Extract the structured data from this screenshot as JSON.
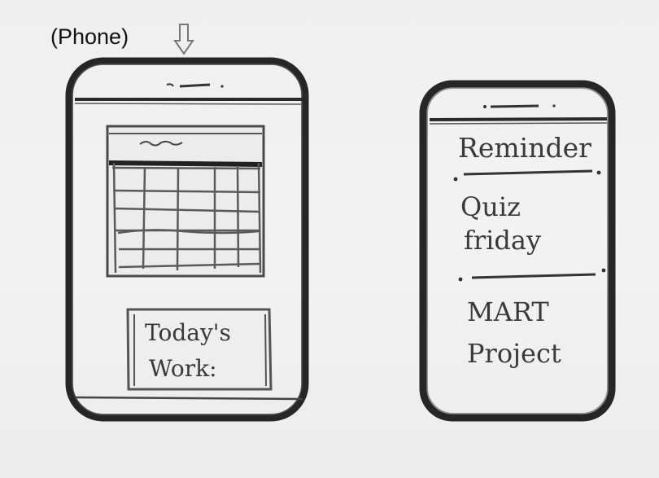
{
  "caption": {
    "phone_label": "(Phone)",
    "arrow_icon": "down-arrow-icon"
  },
  "left_phone": {
    "widgets": {
      "calendar": "calendar-grid",
      "todays_work_label_line1": "Today's",
      "todays_work_label_line2": "Work:"
    }
  },
  "right_phone": {
    "title": "Reminder",
    "items": [
      {
        "line1": "Quiz",
        "line2": "friday"
      },
      {
        "line1": "MART",
        "line2": "Project"
      }
    ]
  },
  "colors": {
    "pencil": "#3a3a3a",
    "paper": "#efefef",
    "outline": "#2a2a2a"
  }
}
